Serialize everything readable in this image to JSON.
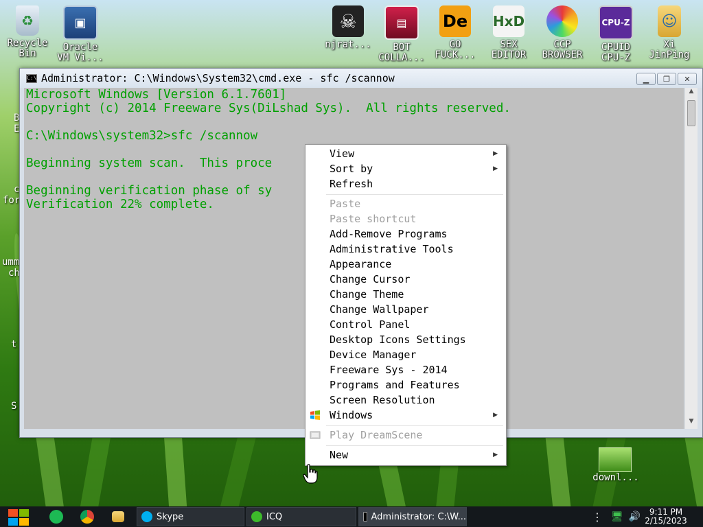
{
  "desktop": {
    "icons": [
      {
        "label": "Recycle\nBin",
        "icon": "recycle-bin-icon"
      },
      {
        "label": "Oracle\nVM Vi...",
        "icon": "virtualbox-icon"
      },
      {
        "label": "njrat...",
        "icon": "skull-icon"
      },
      {
        "label": "BOT\nCOLLA...",
        "icon": "bot-icon"
      },
      {
        "label": "GO\nFUCK...",
        "icon": "de-icon"
      },
      {
        "label": "SEX\nEDITOR",
        "icon": "hxd-icon"
      },
      {
        "label": "CCP\nBROWSER",
        "icon": "browser-icon"
      },
      {
        "label": "CPUID\nCPU-Z",
        "icon": "cpuz-icon"
      },
      {
        "label": "Xi\nJinPing",
        "icon": "user-folder-icon"
      }
    ],
    "edge_fragments": [
      "B",
      "E",
      "c",
      "for",
      "umm",
      "ch",
      "t",
      "S"
    ],
    "download_label": "downl..."
  },
  "cmd": {
    "title": "Administrator: C:\\Windows\\System32\\cmd.exe - sfc  /scannow",
    "lines": [
      "Microsoft Windows [Version 6.1.7601]",
      "Copyright (c) 2014 Freeware Sys(DiLshad Sys).  All rights reserved.",
      "",
      "C:\\Windows\\system32>sfc /scannow",
      "",
      "Beginning system scan.  This proce",
      "",
      "Beginning verification phase of sy",
      "Verification 22% complete."
    ]
  },
  "context_menu": {
    "items": [
      {
        "label": "View",
        "submenu": true,
        "disabled": false
      },
      {
        "label": "Sort by",
        "submenu": true,
        "disabled": false
      },
      {
        "label": "Refresh",
        "submenu": false,
        "disabled": false
      },
      {
        "label": "Paste",
        "submenu": false,
        "disabled": true
      },
      {
        "label": "Paste shortcut",
        "submenu": false,
        "disabled": true
      },
      {
        "label": "Add-Remove Programs",
        "submenu": false,
        "disabled": false
      },
      {
        "label": "Administrative Tools",
        "submenu": false,
        "disabled": false
      },
      {
        "label": "Appearance",
        "submenu": false,
        "disabled": false
      },
      {
        "label": "Change Cursor",
        "submenu": false,
        "disabled": false
      },
      {
        "label": "Change Theme",
        "submenu": false,
        "disabled": false
      },
      {
        "label": "Change Wallpaper",
        "submenu": false,
        "disabled": false
      },
      {
        "label": "Control Panel",
        "submenu": false,
        "disabled": false
      },
      {
        "label": "Desktop Icons Settings",
        "submenu": false,
        "disabled": false
      },
      {
        "label": "Device Manager",
        "submenu": false,
        "disabled": false
      },
      {
        "label": "Freeware Sys - 2014",
        "submenu": false,
        "disabled": false
      },
      {
        "label": "Programs and Features",
        "submenu": false,
        "disabled": false
      },
      {
        "label": "Screen Resolution",
        "submenu": false,
        "disabled": false
      },
      {
        "label": "Windows",
        "submenu": true,
        "disabled": false,
        "icon": "windows-logo-icon"
      },
      {
        "label": "Play DreamScene",
        "submenu": false,
        "disabled": true,
        "icon": "dreamscene-icon"
      },
      {
        "label": "New",
        "submenu": true,
        "disabled": false
      }
    ]
  },
  "taskbar": {
    "tasks": [
      {
        "label": "Skype",
        "icon": "skype-icon"
      },
      {
        "label": "ICQ",
        "icon": "icq-icon"
      },
      {
        "label": "Administrator: C:\\W...",
        "icon": "cmd-icon"
      }
    ],
    "clock": {
      "time": "9:11 PM",
      "date": "2/15/2023"
    }
  },
  "colors": {
    "console_text": "#00a000",
    "console_bg": "#c0c0c0",
    "taskbar_bg": "#14181c"
  }
}
